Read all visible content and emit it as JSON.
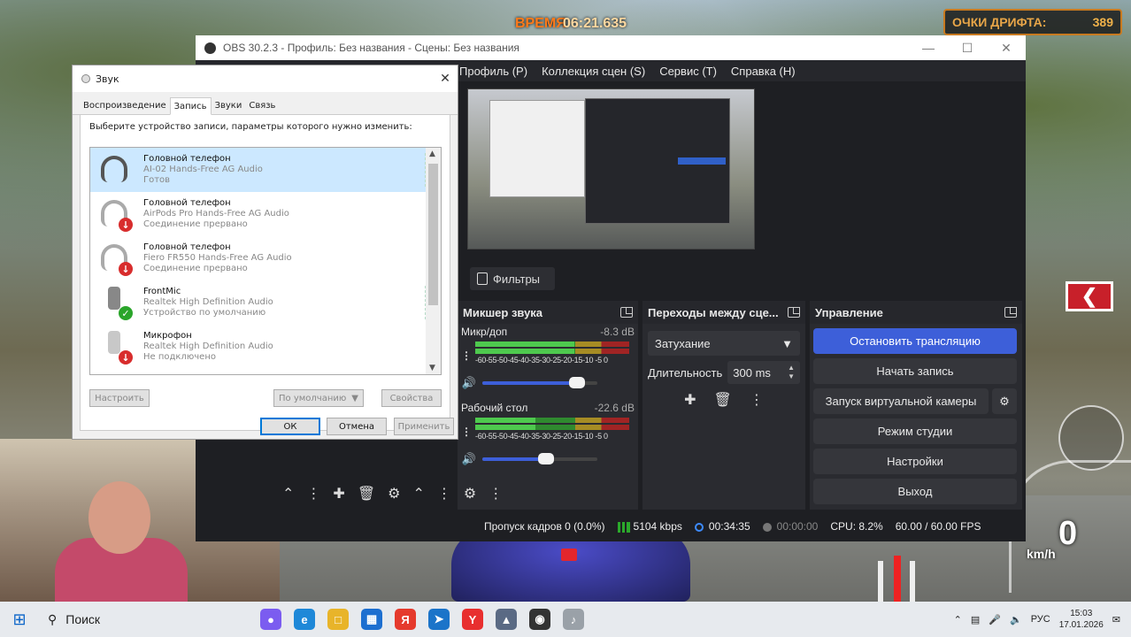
{
  "game": {
    "time_label": "ВРЕМЯ",
    "time_value": "06:21.635",
    "drift_label": "ОЧКИ ДРИФТА:",
    "drift_value": "389",
    "speed_value": "0",
    "speed_unit": "km/h"
  },
  "obs": {
    "title": "OBS 30.2.3 - Профиль: Без названия - Сцены: Без названия",
    "menu": [
      "Профиль (P)",
      "Коллекция сцен (S)",
      "Сервис (T)",
      "Справка (H)"
    ],
    "filters_label": "Фильтры",
    "mixer": {
      "title": "Микшер звука",
      "channels": [
        {
          "name": "Микр/доп",
          "db": "-8.3 dB",
          "level": 0.62,
          "volume": 0.82
        },
        {
          "name": "Рабочий стол",
          "db": "-22.6 dB",
          "level": 0.38,
          "volume": 0.55
        }
      ],
      "scale": "-60-55-50-45-40-35-30-25-20-15-10 -5  0"
    },
    "transitions": {
      "title": "Переходы между сце...",
      "selected": "Затухание",
      "duration_label": "Длительность",
      "duration_value": "300 ms"
    },
    "controls": {
      "title": "Управление",
      "stop_stream": "Остановить трансляцию",
      "start_record": "Начать запись",
      "virtual_cam": "Запуск виртуальной камеры",
      "studio_mode": "Режим студии",
      "settings": "Настройки",
      "exit": "Выход"
    },
    "status": {
      "dropped": "Пропуск кадров 0 (0.0%)",
      "bitrate": "5104 kbps",
      "stream_time": "00:34:35",
      "rec_time": "00:00:00",
      "cpu": "CPU: 8.2%",
      "fps": "60.00 / 60.00 FPS"
    }
  },
  "sound": {
    "title": "Звук",
    "tabs": [
      "Воспроизведение",
      "Запись",
      "Звуки",
      "Связь"
    ],
    "description": "Выберите устройство записи, параметры которого нужно изменить:",
    "devices": [
      {
        "name": "Головной телефон",
        "driver": "AI-02 Hands-Free AG Audio",
        "status": "Готов"
      },
      {
        "name": "Головной телефон",
        "driver": "AirPods Pro Hands-Free AG Audio",
        "status": "Соединение прервано"
      },
      {
        "name": "Головной телефон",
        "driver": "Fiero FR550 Hands-Free AG Audio",
        "status": "Соединение прервано"
      },
      {
        "name": "FrontMic",
        "driver": "Realtek High Definition Audio",
        "status": "Устройство по умолчанию"
      },
      {
        "name": "Микрофон",
        "driver": "Realtek High Definition Audio",
        "status": "Не подключено"
      }
    ],
    "buttons": {
      "configure": "Настроить",
      "default": "По умолчанию",
      "properties": "Свойства",
      "ok": "ОК",
      "cancel": "Отмена",
      "apply": "Применить"
    }
  },
  "taskbar": {
    "search": "Поиск",
    "lang": "РУС",
    "time": "15:03",
    "date": "17.01.2026"
  }
}
